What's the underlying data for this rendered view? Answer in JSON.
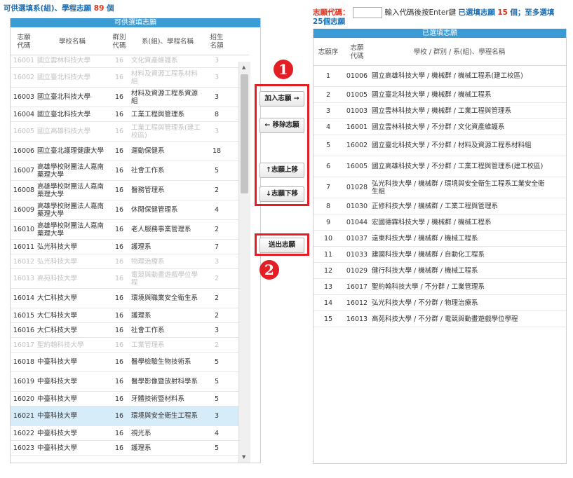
{
  "left": {
    "title_prefix": "可供選填系(組)、學程志願",
    "title_count": "89",
    "title_suffix": "個",
    "bar": "可供選填志願",
    "headers": [
      "志願\n代碼",
      "學校名稱",
      "群別\n代碼",
      "系(組)、學程名稱",
      "招生\n名額"
    ],
    "rows": [
      {
        "code": "16001",
        "school": "國立雲林科技大學",
        "group": "16",
        "dept": "文化資產維護系",
        "quota": "3",
        "dim": true
      },
      {
        "code": "16002",
        "school": "國立臺北科技大學",
        "group": "16",
        "dept": "材料及資源工程系材料組",
        "quota": "3",
        "dim": true
      },
      {
        "code": "16003",
        "school": "國立臺北科技大學",
        "group": "16",
        "dept": "材料及資源工程系資源組",
        "quota": "3",
        "dim": false
      },
      {
        "code": "16004",
        "school": "國立臺北科技大學",
        "group": "16",
        "dept": "工業工程與管理系",
        "quota": "8",
        "dim": false
      },
      {
        "code": "16005",
        "school": "國立高雄科技大學",
        "group": "16",
        "dept": "工業工程與管理系(建工校區)",
        "quota": "3",
        "dim": true
      },
      {
        "code": "16006",
        "school": "國立臺北護理健康大學",
        "group": "16",
        "dept": "運動保健系",
        "quota": "18",
        "dim": false
      },
      {
        "code": "16007",
        "school": "高雄學校財團法人嘉南藥理大學",
        "group": "16",
        "dept": "社會工作系",
        "quota": "5",
        "dim": false
      },
      {
        "code": "16008",
        "school": "高雄學校財團法人嘉南藥理大學",
        "group": "16",
        "dept": "醫務管理系",
        "quota": "2",
        "dim": false
      },
      {
        "code": "16009",
        "school": "高雄學校財團法人嘉南藥理大學",
        "group": "16",
        "dept": "休閒保健管理系",
        "quota": "4",
        "dim": false
      },
      {
        "code": "16010",
        "school": "高雄學校財團法人嘉南藥理大學",
        "group": "16",
        "dept": "老人服務事業管理系",
        "quota": "2",
        "dim": false
      },
      {
        "code": "16011",
        "school": "弘光科技大學",
        "group": "16",
        "dept": "護理系",
        "quota": "7",
        "dim": false
      },
      {
        "code": "16012",
        "school": "弘光科技大學",
        "group": "16",
        "dept": "物理治療系",
        "quota": "3",
        "dim": true
      },
      {
        "code": "16013",
        "school": "高苑科技大學",
        "group": "16",
        "dept": "電競與動畫遊戲學位學程",
        "quota": "2",
        "dim": true
      },
      {
        "code": "16014",
        "school": "大仁科技大學",
        "group": "16",
        "dept": "環境與職業安全衛生系",
        "quota": "2",
        "dim": false
      },
      {
        "code": "16015",
        "school": "大仁科技大學",
        "group": "16",
        "dept": "護理系",
        "quota": "2",
        "dim": false
      },
      {
        "code": "16016",
        "school": "大仁科技大學",
        "group": "16",
        "dept": "社會工作系",
        "quota": "3",
        "dim": false
      },
      {
        "code": "16017",
        "school": "聖約翰科技大學",
        "group": "16",
        "dept": "工業管理系",
        "quota": "2",
        "dim": true
      },
      {
        "code": "16018",
        "school": "中臺科技大學",
        "group": "16",
        "dept": "醫學檢驗生物技術系",
        "quota": "5",
        "dim": false
      },
      {
        "code": "16019",
        "school": "中臺科技大學",
        "group": "16",
        "dept": "醫學影像暨放射科學系",
        "quota": "5",
        "dim": false
      },
      {
        "code": "16020",
        "school": "中臺科技大學",
        "group": "16",
        "dept": "牙體技術暨材料系",
        "quota": "5",
        "dim": false
      },
      {
        "code": "16021",
        "school": "中臺科技大學",
        "group": "16",
        "dept": "環境與安全衛生工程系",
        "quota": "3",
        "dim": false,
        "selected": true
      },
      {
        "code": "16022",
        "school": "中臺科技大學",
        "group": "16",
        "dept": "視光系",
        "quota": "4",
        "dim": false
      },
      {
        "code": "16023",
        "school": "中臺科技大學",
        "group": "16",
        "dept": "護理系",
        "quota": "5",
        "dim": false
      }
    ]
  },
  "buttons": {
    "add": "加入志願 →",
    "remove": "← 移除志願",
    "up": "↑志願上移",
    "down": "↓志願下移",
    "submit": "送出志願",
    "badge1": "1",
    "badge2": "2"
  },
  "right": {
    "code_label": "志願代碼：",
    "code_hint": "輸入代碼後按Enter鍵",
    "selected_prefix": "已選填志願",
    "selected_count": "15",
    "selected_suffix": "個；至多選填",
    "max_line": "25個志願",
    "bar": "已選填志願",
    "headers": [
      "志願序",
      "志願\n代碼",
      "學校 / 群別 / 系(組)、學程名稱"
    ],
    "rows": [
      {
        "order": "1",
        "code": "01006",
        "name": "國立高雄科技大學 / 機械群 / 機械工程系(建工校區)"
      },
      {
        "order": "2",
        "code": "01005",
        "name": "國立臺北科技大學 / 機械群 / 機械工程系"
      },
      {
        "order": "3",
        "code": "01003",
        "name": "國立雲林科技大學 / 機械群 / 工業工程與管理系"
      },
      {
        "order": "4",
        "code": "16001",
        "name": "國立雲林科技大學 / 不分群 / 文化資產維護系"
      },
      {
        "order": "5",
        "code": "16002",
        "name": "國立臺北科技大學 / 不分群 / 材料及資源工程系材料組"
      },
      {
        "order": "6",
        "code": "16005",
        "name": "國立高雄科技大學 / 不分群 / 工業工程與管理系(建工校區)"
      },
      {
        "order": "7",
        "code": "01028",
        "name": "弘光科技大學 / 機械群 / 環境與安全衛生工程系工業安全衛生組"
      },
      {
        "order": "8",
        "code": "01030",
        "name": "正修科技大學 / 機械群 / 工業工程與管理系"
      },
      {
        "order": "9",
        "code": "01044",
        "name": "宏國德霖科技大學 / 機械群 / 機械工程系"
      },
      {
        "order": "10",
        "code": "01037",
        "name": "遠東科技大學 / 機械群 / 機械工程系"
      },
      {
        "order": "11",
        "code": "01033",
        "name": "建國科技大學 / 機械群 / 自動化工程系"
      },
      {
        "order": "12",
        "code": "01029",
        "name": "健行科技大學 / 機械群 / 機械工程系"
      },
      {
        "order": "13",
        "code": "16017",
        "name": "聖約翰科技大學 / 不分群 / 工業管理系"
      },
      {
        "order": "14",
        "code": "16012",
        "name": "弘光科技大學 / 不分群 / 物理治療系"
      },
      {
        "order": "15",
        "code": "16013",
        "name": "高苑科技大學 / 不分群 / 電競與動畫遊戲學位學程"
      }
    ]
  },
  "colors": {
    "accent_bar": "#3a9bd5",
    "highlight": "#e31e24",
    "selected_row": "#d7ecf9"
  }
}
